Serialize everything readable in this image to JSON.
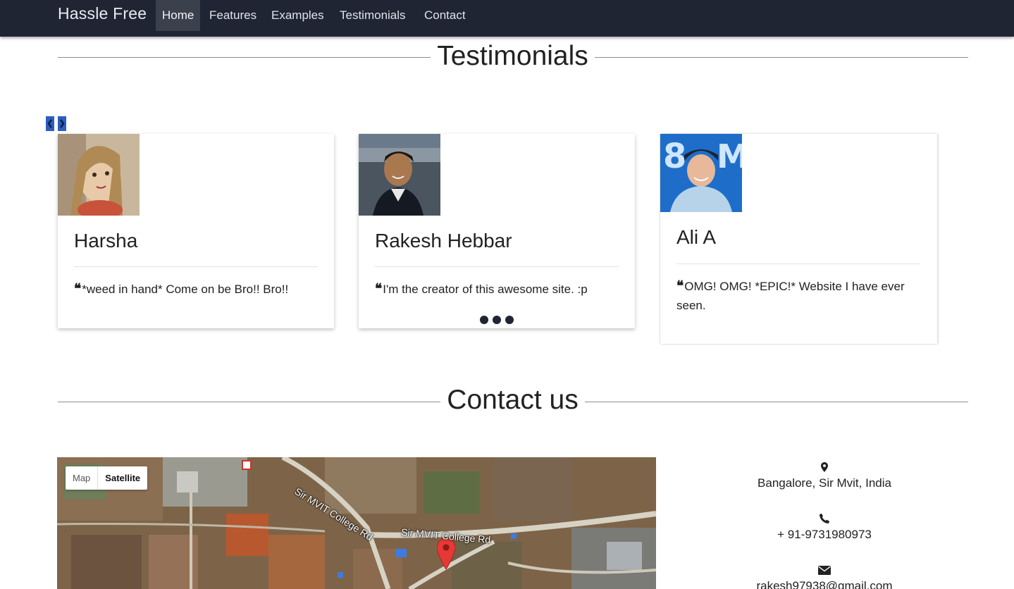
{
  "navbar": {
    "brand": "Hassle Free",
    "items": [
      {
        "label": "Home",
        "active": true
      },
      {
        "label": "Features",
        "active": false
      },
      {
        "label": "Examples",
        "active": false
      },
      {
        "label": "Testimonials",
        "active": false
      },
      {
        "label": "Contact",
        "active": false
      }
    ]
  },
  "testimonials": {
    "title": "Testimonials",
    "carousel": {
      "prev_icon": "chevron-left-icon",
      "next_icon": "chevron-right-icon"
    },
    "cards": [
      {
        "name": "Harsha",
        "quote": "*weed in hand* Come on be Bro!! Bro!!"
      },
      {
        "name": "Rakesh Hebbar",
        "quote": "I'm the creator of this awesome site. :p"
      },
      {
        "name": "Ali A",
        "quote": "OMG! OMG! *EPIC!* Website I have ever seen."
      }
    ],
    "quote_mark": "❝"
  },
  "contact": {
    "title": "Contact us",
    "map": {
      "map_label": "Map",
      "satellite_label": "Satellite",
      "satellite_selected": true,
      "roads": [
        "Sir MVIT College Rd",
        "Sir MVIT College Rd"
      ]
    },
    "address": "Bangalore, Sir Mvit, India",
    "phone": "+ 91-9731980973",
    "email": "rakesh97938@gmail.com"
  },
  "colors": {
    "navbar_bg": "#1f2533",
    "accent": "#2c5fbf",
    "pin": "#e53935"
  }
}
